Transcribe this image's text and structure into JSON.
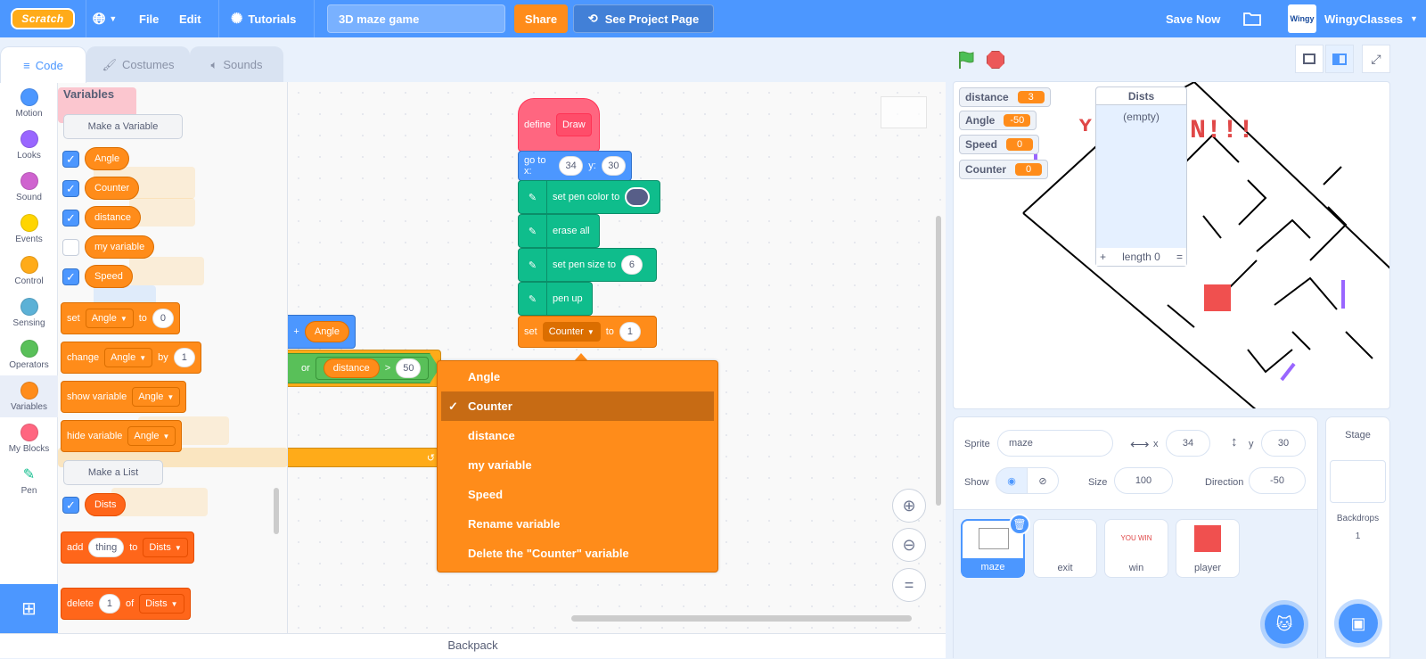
{
  "menubar": {
    "logo": "Scratch",
    "file": "File",
    "edit": "Edit",
    "tutorials": "Tutorials",
    "project_title": "3D maze game",
    "share": "Share",
    "see_project_page": "See Project Page",
    "save_now": "Save Now",
    "username": "WingyClasses",
    "avatar_text": "Wingy"
  },
  "tabs": [
    {
      "label": "Code",
      "active": true
    },
    {
      "label": "Costumes",
      "active": false
    },
    {
      "label": "Sounds",
      "active": false
    }
  ],
  "categories": [
    {
      "label": "Motion",
      "color": "#4c97ff"
    },
    {
      "label": "Looks",
      "color": "#9966ff"
    },
    {
      "label": "Sound",
      "color": "#cf63cf"
    },
    {
      "label": "Events",
      "color": "#ffd500"
    },
    {
      "label": "Control",
      "color": "#ffab19"
    },
    {
      "label": "Sensing",
      "color": "#5cb1d6"
    },
    {
      "label": "Operators",
      "color": "#59c059"
    },
    {
      "label": "Variables",
      "color": "#ff8c1a",
      "selected": true
    },
    {
      "label": "My Blocks",
      "color": "#ff6680"
    },
    {
      "label": "Pen",
      "color": "#0fbd8c"
    }
  ],
  "palette": {
    "title": "Variables",
    "make_variable": "Make a Variable",
    "variables": [
      {
        "name": "Angle",
        "checked": true
      },
      {
        "name": "Counter",
        "checked": true
      },
      {
        "name": "distance",
        "checked": true
      },
      {
        "name": "my variable",
        "checked": false
      },
      {
        "name": "Speed",
        "checked": true
      }
    ],
    "set_block": {
      "label": "set",
      "var": "Angle",
      "to": "to",
      "value": "0"
    },
    "change_block": {
      "label": "change",
      "var": "Angle",
      "by": "by",
      "value": "1"
    },
    "show_block": {
      "label": "show variable",
      "var": "Angle"
    },
    "hide_block": {
      "label": "hide variable",
      "var": "Angle"
    },
    "make_list": "Make a List",
    "lists": [
      {
        "name": "Dists",
        "checked": true
      }
    ],
    "add_block": {
      "label": "add",
      "value": "thing",
      "to": "to",
      "list": "Dists"
    },
    "delete_block": {
      "label": "delete",
      "value": "1",
      "of": "of",
      "list": "Dists"
    }
  },
  "workspace": {
    "define": {
      "label": "define",
      "name": "Draw"
    },
    "goto": {
      "label": "go to x:",
      "x": "34",
      "ylabel": "y:",
      "y": "30"
    },
    "pen_color": "set pen color to",
    "erase_all": "erase all",
    "pen_size": {
      "label": "set pen size to",
      "value": "6"
    },
    "pen_up": "pen up",
    "set_counter": {
      "label": "set",
      "var": "Counter",
      "to": "to",
      "value": "1"
    },
    "partial_add": {
      "plus": "+",
      "var": "Angle"
    },
    "partial_or": {
      "or": "or",
      "var": "distance",
      "op": ">",
      "value": "50"
    }
  },
  "context_menu": {
    "items": [
      {
        "label": "Angle",
        "checked": false
      },
      {
        "label": "Counter",
        "checked": true
      },
      {
        "label": "distance",
        "checked": false
      },
      {
        "label": "my variable",
        "checked": false
      },
      {
        "label": "Speed",
        "checked": false
      },
      {
        "label": "Rename variable",
        "checked": false
      },
      {
        "label": "Delete the \"Counter\" variable",
        "checked": false
      }
    ],
    "check_glyph": "✓"
  },
  "backpack": "Backpack",
  "stage": {
    "monitors": [
      {
        "label": "distance",
        "value": "3"
      },
      {
        "label": "Angle",
        "value": "-50"
      },
      {
        "label": "Speed",
        "value": "0"
      },
      {
        "label": "Counter",
        "value": "0"
      }
    ],
    "list_monitor": {
      "title": "Dists",
      "empty": "(empty)",
      "add": "+",
      "length": "length 0",
      "resize": "="
    }
  },
  "sprite_info": {
    "sprite_label": "Sprite",
    "sprite_name": "maze",
    "x_label": "x",
    "x": "34",
    "y_label": "y",
    "y": "30",
    "show_label": "Show",
    "size_label": "Size",
    "size": "100",
    "direction_label": "Direction",
    "direction": "-50"
  },
  "sprites": [
    {
      "name": "maze",
      "selected": true
    },
    {
      "name": "exit",
      "selected": false
    },
    {
      "name": "win",
      "selected": false,
      "thumb_text": "YOU WIN"
    },
    {
      "name": "player",
      "selected": false
    }
  ],
  "stage_panel": {
    "title": "Stage",
    "backdrops_label": "Backdrops",
    "backdrops_count": "1"
  }
}
